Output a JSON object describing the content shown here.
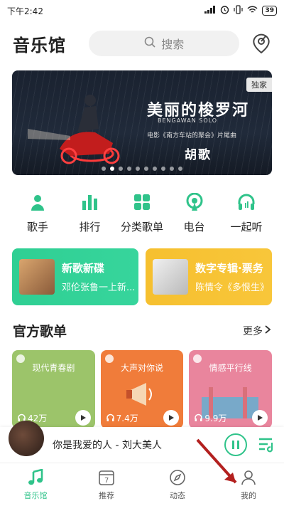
{
  "status_bar": {
    "time": "下午2:42",
    "battery": "39"
  },
  "header": {
    "title": "音乐馆",
    "search_placeholder": "搜索"
  },
  "banner": {
    "tag": "独家",
    "title": "美丽的梭罗河",
    "subtitle": "BENGAWAN SOLO",
    "line": "电影《南方车站的聚会》片尾曲",
    "artist": "胡歌",
    "dots_total": 10,
    "dots_active": 1
  },
  "categories": [
    {
      "label": "歌手",
      "icon": "singer-icon"
    },
    {
      "label": "排行",
      "icon": "chart-icon"
    },
    {
      "label": "分类歌单",
      "icon": "category-icon"
    },
    {
      "label": "电台",
      "icon": "radio-icon"
    },
    {
      "label": "一起听",
      "icon": "headphones-icon"
    }
  ],
  "promos": [
    {
      "title": "新歌新碟",
      "subtitle": "邓伦张鲁一上新..."
    },
    {
      "title": "数字专辑·票务",
      "subtitle": "陈情令《多恨生》"
    }
  ],
  "official": {
    "title": "官方歌单",
    "more": "更多",
    "playlists": [
      {
        "name": "现代青春剧",
        "count": "42万"
      },
      {
        "name": "大声对你说",
        "count": "7.4万"
      },
      {
        "name": "情感平行线",
        "count": "9.9万"
      }
    ]
  },
  "player": {
    "song": "你是我爱的人 - 刘大美人"
  },
  "tabs": [
    {
      "label": "音乐馆",
      "icon": "music-note-icon",
      "active": true
    },
    {
      "label": "推荐",
      "icon": "calendar-icon",
      "active": false
    },
    {
      "label": "动态",
      "icon": "compass-icon",
      "active": false
    },
    {
      "label": "我的",
      "icon": "person-icon",
      "active": false
    }
  ],
  "colors": {
    "accent": "#2fc38a",
    "promo_green": "#31d196",
    "promo_yellow": "#f7c233"
  }
}
